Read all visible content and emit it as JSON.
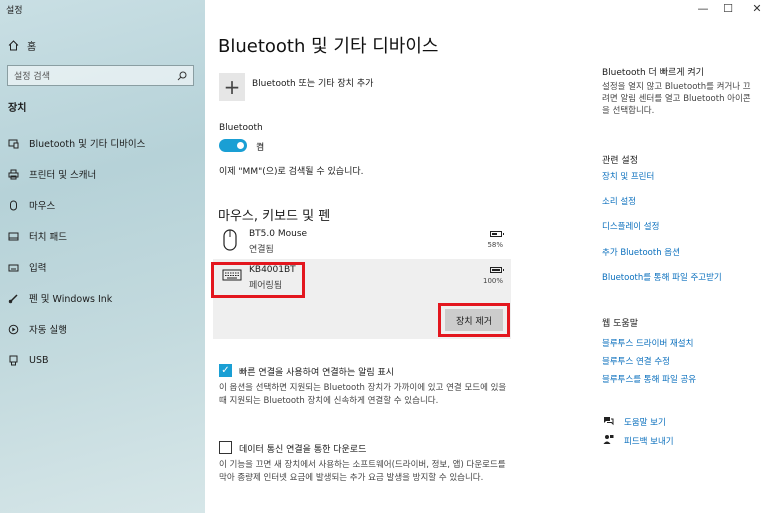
{
  "window": {
    "title": "설정",
    "controls": [
      "—",
      "☐",
      "✕"
    ]
  },
  "sidebar": {
    "home_label": "홈",
    "search_placeholder": "설정 검색",
    "section_title": "장치",
    "items": [
      {
        "label": "Bluetooth 및 기타 디바이스",
        "icon": "bluetooth-devices-icon"
      },
      {
        "label": "프린터 및 스캐너",
        "icon": "printer-icon"
      },
      {
        "label": "마우스",
        "icon": "mouse-icon"
      },
      {
        "label": "터치 패드",
        "icon": "touchpad-icon"
      },
      {
        "label": "입력",
        "icon": "keyboard-icon"
      },
      {
        "label": "펜 및 Windows Ink",
        "icon": "pen-icon"
      },
      {
        "label": "자동 실행",
        "icon": "autoplay-icon"
      },
      {
        "label": "USB",
        "icon": "usb-icon"
      }
    ]
  },
  "main": {
    "title": "Bluetooth 및 기타 디바이스",
    "add_device_label": "Bluetooth 또는 기타 장치 추가",
    "bluetooth_label": "Bluetooth",
    "toggle_state": "켬",
    "discoverable_text": "이제 \"MM\"(으)로 검색될 수 있습니다.",
    "section_mouse": "마우스, 키보드 및 펜",
    "devices": [
      {
        "name": "BT5.0 Mouse",
        "status": "연결됨",
        "battery": "58%",
        "battery_level": 0.58
      },
      {
        "name": "KB4001BT",
        "status": "페어링됨",
        "battery": "100%",
        "battery_level": 1.0
      }
    ],
    "remove_button": "장치 제거",
    "swift_pair_label": "빠른 연결을 사용하여 연결하는 알림 표시",
    "swift_pair_desc": "이 옵션을 선택하면 지원되는 Bluetooth 장치가 가까이에 있고 연결 모드에 있을 때 지원되는 Bluetooth 장치에 신속하게 연결할 수 있습니다.",
    "metered_label": "데이터 통신 연결을 통한 다운로드",
    "metered_desc": "이 기능을 끄면 새 장치에서 사용하는 소프트웨어(드라이버, 정보, 앱) 다운로드를 막아 종량제 인터넷 요금에 발생되는 추가 요금 발생을 방지할 수 있습니다."
  },
  "right": {
    "quick_title": "Bluetooth 더 빠르게 켜기",
    "quick_text": "설정을 열지 않고 Bluetooth를 켜거나 끄려면 알림 센터를 열고 Bluetooth 아이콘을 선택합니다.",
    "related_title": "관련 설정",
    "related_links": [
      "장치 및 프린터",
      "소리 설정",
      "디스플레이 설정",
      "추가 Bluetooth 옵션",
      "Bluetooth를 통해 파일 주고받기"
    ],
    "help_title": "웹 도움말",
    "help_links": [
      "블루투스 드라이버 재설치",
      "블루투스 연결 수정",
      "블루투스를 통해 파일 공유"
    ],
    "get_help": "도움말 보기",
    "feedback": "피드백 보내기"
  },
  "colors": {
    "accent": "#1a9fd4",
    "highlight": "#e3161e",
    "link": "#0a6fbd"
  }
}
